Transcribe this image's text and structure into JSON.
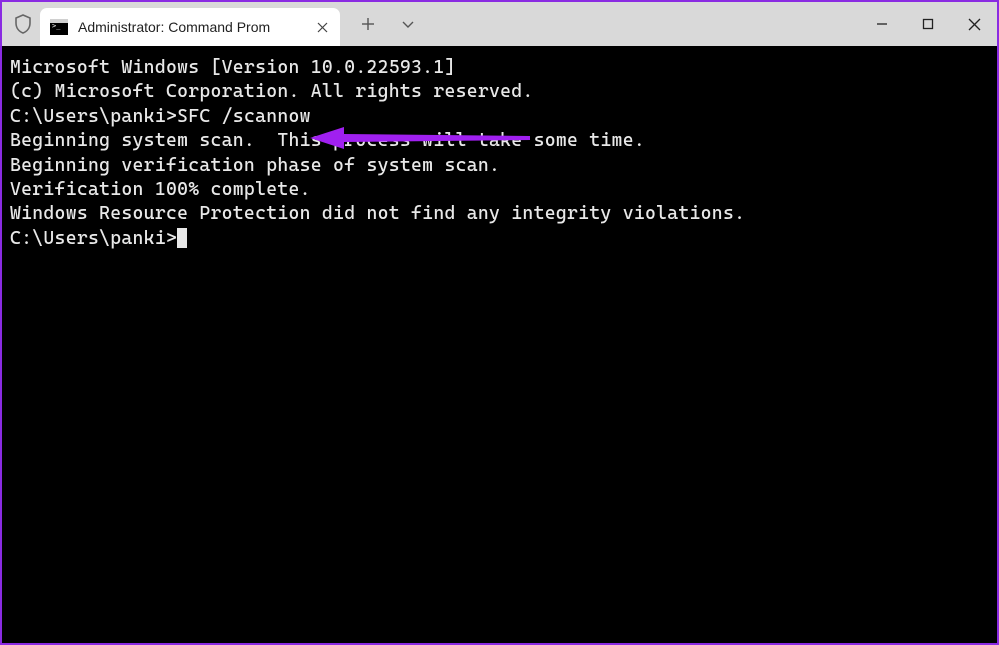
{
  "window": {
    "tab_title": "Administrator: Command Prom",
    "icons": {
      "shield": "shield-icon",
      "terminal": "terminal-icon",
      "close_tab": "close-icon",
      "new_tab": "plus-icon",
      "dropdown": "chevron-down-icon",
      "minimize": "minimize-icon",
      "maximize": "maximize-icon",
      "close_window": "close-icon"
    }
  },
  "terminal": {
    "line1": "Microsoft Windows [Version 10.0.22593.1]",
    "line2": "(c) Microsoft Corporation. All rights reserved.",
    "blank1": "",
    "prompt1_path": "C:\\Users\\panki>",
    "prompt1_cmd": "SFC /scannow",
    "blank2": "",
    "line_begin_scan": "Beginning system scan.  This process will take some time.",
    "blank3": "",
    "line_begin_verif": "Beginning verification phase of system scan.",
    "line_verif_done": "Verification 100% complete.",
    "blank4": "",
    "line_result": "Windows Resource Protection did not find any integrity violations.",
    "blank5": "",
    "prompt2_path": "C:\\Users\\panki>"
  },
  "annotation": {
    "color": "#a020f0"
  }
}
